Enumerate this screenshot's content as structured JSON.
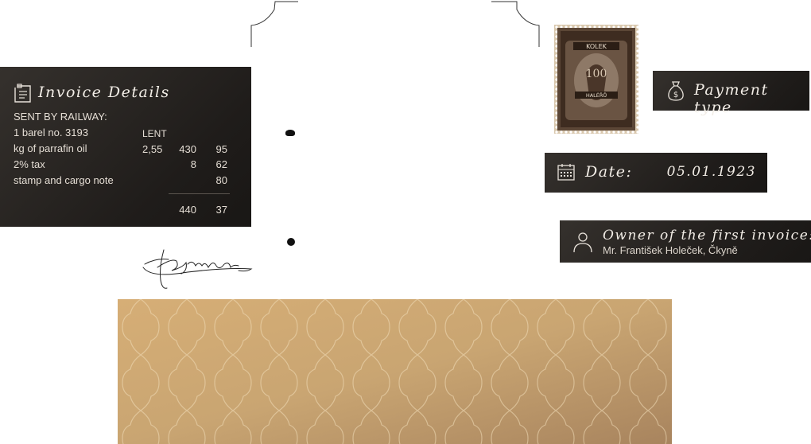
{
  "invoice": {
    "title": "Invoice Details",
    "sent_by": "SENT BY RAILWAY:",
    "rows": [
      {
        "label": "1 barel no. 3193",
        "a": "LENT",
        "b": "",
        "c": ""
      },
      {
        "label": "kg of parrafin oil",
        "a": "2,55",
        "b": "430",
        "c": "95"
      },
      {
        "label": "2% tax",
        "a": "",
        "b": "8",
        "c": "62"
      },
      {
        "label": "stamp and cargo note",
        "a": "",
        "b": "",
        "c": "80"
      }
    ],
    "total_b": "440",
    "total_c": "37"
  },
  "payment": {
    "label": "Payment type"
  },
  "date": {
    "label": "Date:",
    "value": "05.01.1923"
  },
  "owner": {
    "label": "Owner of the first invoice:",
    "value": "Mr. František Holeček, Čkyně"
  },
  "stamp": {
    "text_top": "KOLEK",
    "text_mid": "HALÉŘŮ",
    "value": "100"
  },
  "signature": {
    "text": "Hg'enka"
  },
  "colors": {
    "panel": "#2a2623",
    "pattern": "#c9a572",
    "ink": "#111111"
  },
  "icons": {
    "invoice": "document-icon",
    "payment": "money-bag-icon",
    "date": "calendar-icon",
    "owner": "user-icon"
  }
}
